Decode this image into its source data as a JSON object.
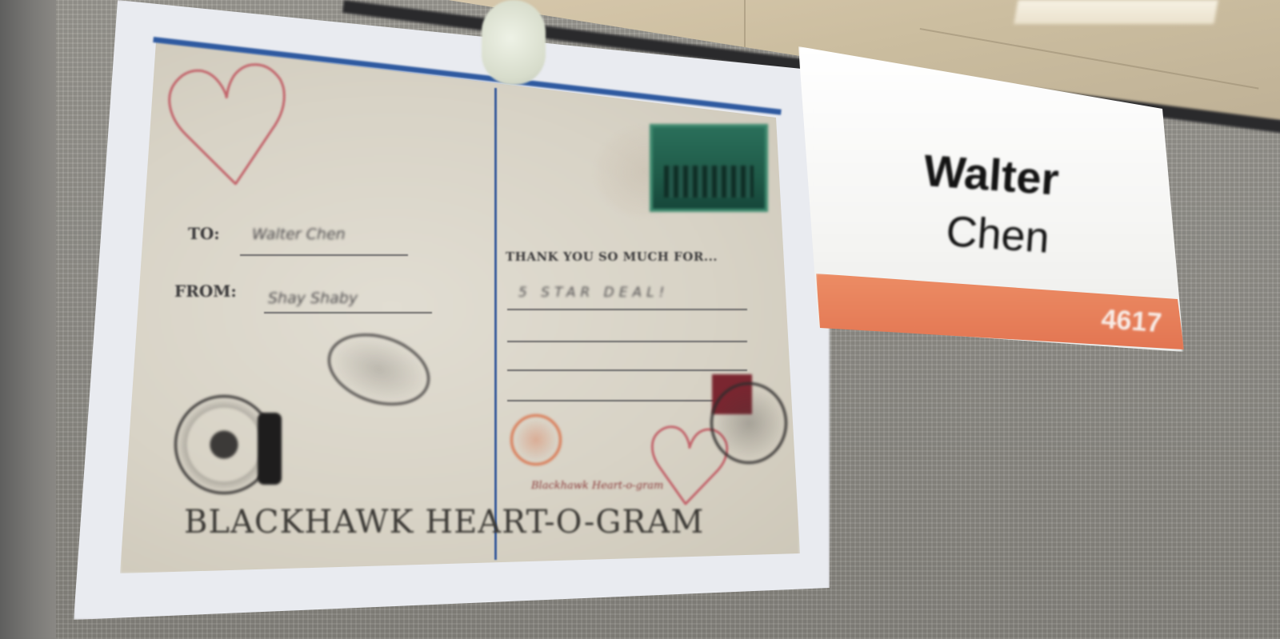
{
  "postcard": {
    "to_label": "TO:",
    "to_value": "Walter Chen",
    "from_label": "FROM:",
    "from_value": "Shay Shaby",
    "thanks_label": "THANK YOU SO MUCH FOR...",
    "thanks_value": "5 STAR DEAL!",
    "script_text": "Blackhawk Heart-o-gram",
    "title": "BLACKHAWK HEART-O-GRAM"
  },
  "nameplate": {
    "first_name": "Walter",
    "last_name": "Chen",
    "number": "4617"
  },
  "colors": {
    "nameplate_band": "#e27451",
    "card_rule_blue": "#2f5aa0",
    "heart_red": "#c2636a",
    "stamp_green": "#1f5a48"
  }
}
